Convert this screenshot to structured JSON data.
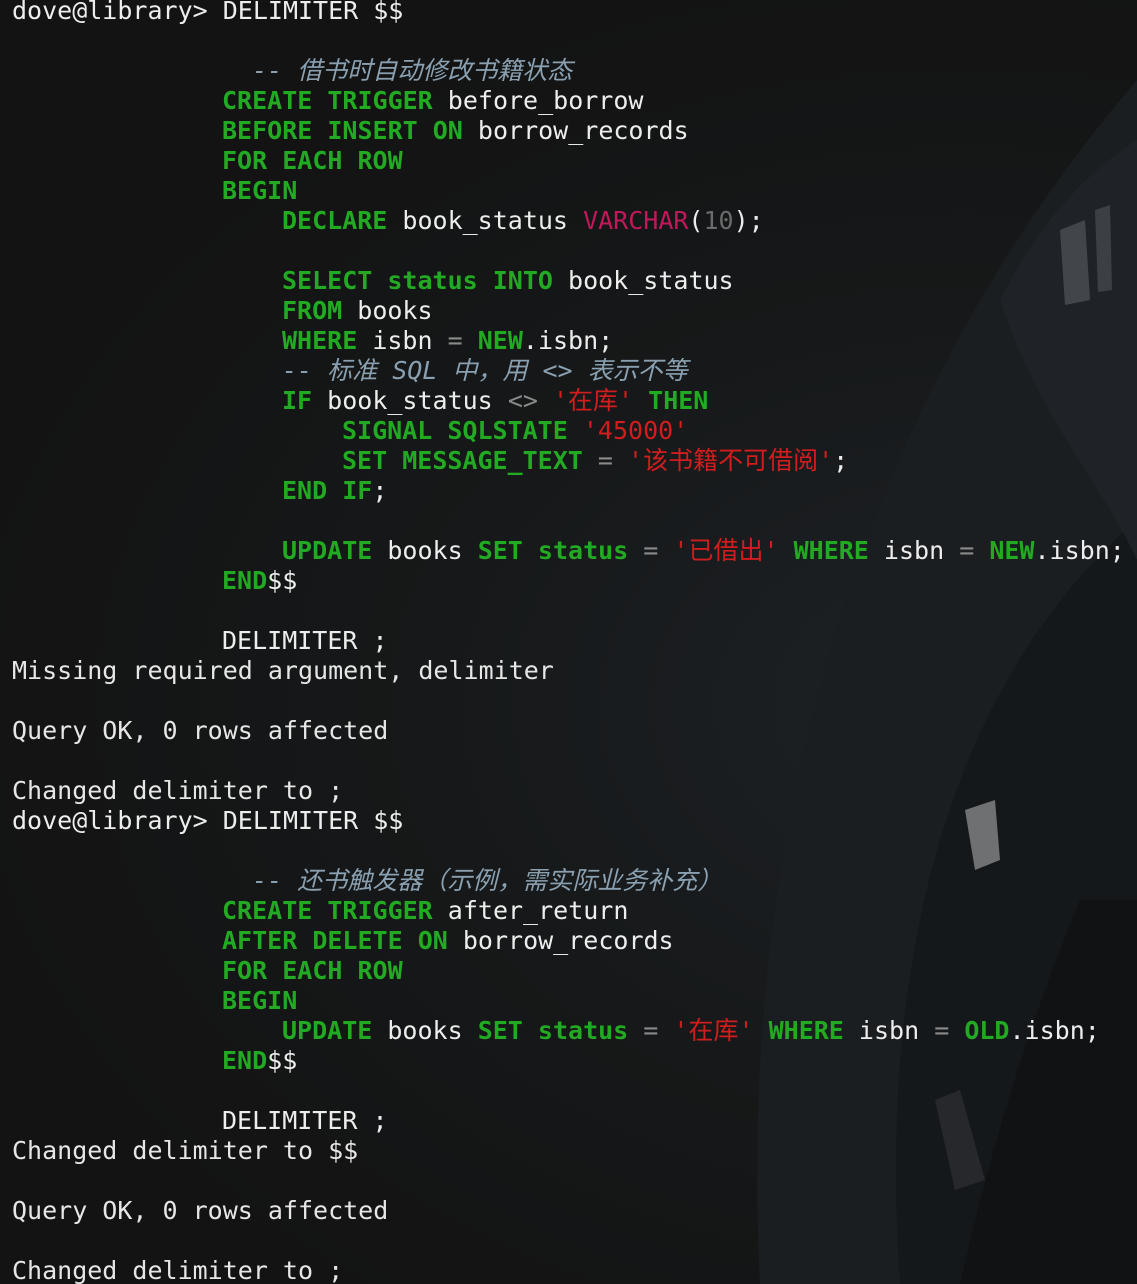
{
  "prompt": "dove@library>",
  "cmd": "DELIMITER $$",
  "kw": {
    "create": "CREATE",
    "trigger": "TRIGGER",
    "before": "BEFORE",
    "after": "AFTER",
    "insert": "INSERT",
    "delete": "DELETE",
    "on": "ON",
    "for": "FOR",
    "each": "EACH",
    "row": "ROW",
    "begin": "BEGIN",
    "declare": "DECLARE",
    "select": "SELECT",
    "status": "status",
    "into": "INTO",
    "from": "FROM",
    "where": "WHERE",
    "new": "NEW",
    "old": "OLD",
    "if": "IF",
    "then": "THEN",
    "signal": "SIGNAL",
    "sqlstate": "SQLSTATE",
    "set": "SET",
    "message_text": "MESSAGE_TEXT",
    "end": "END",
    "update": "UPDATE"
  },
  "sql1": {
    "comment": "-- 借书时自动修改书籍状态",
    "trigger_name": "before_borrow",
    "table": "borrow_records",
    "var": "book_status",
    "type": "VARCHAR",
    "paren_open": "(",
    "len": "10",
    "paren_close_semi": ");",
    "books": "books",
    "isbn": "isbn",
    "eq": "=",
    "neq": "<>",
    "dot_isbn_semi": ".isbn;",
    "comment2": "-- 标准 SQL 中，用 <> 表示不等",
    "str_in_stock": "'在库'",
    "str_state": "'45000'",
    "str_msg": "'该书籍不可借阅'",
    "semi": ";",
    "str_borrowed": "'已借出'",
    "end_dd": "$$"
  },
  "delim_semi": "DELIMITER ;",
  "out1": "Missing required argument, delimiter",
  "out2": "Query OK, 0 rows affected",
  "out3": "Changed delimiter to ;",
  "sql2": {
    "comment": "-- 还书触发器（示例，需实际业务补充）",
    "trigger_name": "after_return",
    "table": "borrow_records",
    "books": "books",
    "isbn": "isbn",
    "eq": "=",
    "str_in_stock": "'在库'",
    "dot_isbn_semi": ".isbn;",
    "end_dd": "$$"
  },
  "out4": "Changed delimiter to $$",
  "out5": "Query OK, 0 rows affected",
  "out6": "Changed delimiter to ;",
  "colors": {
    "keyword": "#22aa22",
    "string": "#d11d1d",
    "type": "#c0185a",
    "comment": "#8aa0b0",
    "text": "#ededed",
    "background": "#141414"
  }
}
